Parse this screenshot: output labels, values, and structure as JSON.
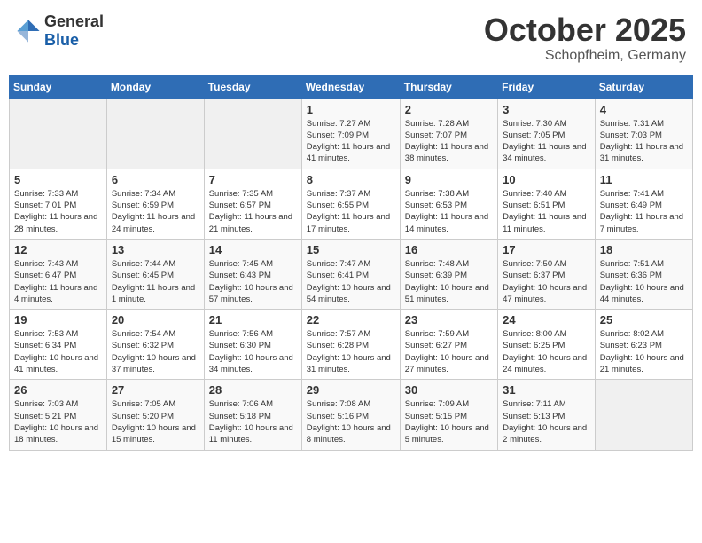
{
  "header": {
    "logo_general": "General",
    "logo_blue": "Blue",
    "month": "October 2025",
    "location": "Schopfheim, Germany"
  },
  "weekdays": [
    "Sunday",
    "Monday",
    "Tuesday",
    "Wednesday",
    "Thursday",
    "Friday",
    "Saturday"
  ],
  "weeks": [
    [
      {
        "day": "",
        "sunrise": "",
        "sunset": "",
        "daylight": ""
      },
      {
        "day": "",
        "sunrise": "",
        "sunset": "",
        "daylight": ""
      },
      {
        "day": "",
        "sunrise": "",
        "sunset": "",
        "daylight": ""
      },
      {
        "day": "1",
        "sunrise": "Sunrise: 7:27 AM",
        "sunset": "Sunset: 7:09 PM",
        "daylight": "Daylight: 11 hours and 41 minutes."
      },
      {
        "day": "2",
        "sunrise": "Sunrise: 7:28 AM",
        "sunset": "Sunset: 7:07 PM",
        "daylight": "Daylight: 11 hours and 38 minutes."
      },
      {
        "day": "3",
        "sunrise": "Sunrise: 7:30 AM",
        "sunset": "Sunset: 7:05 PM",
        "daylight": "Daylight: 11 hours and 34 minutes."
      },
      {
        "day": "4",
        "sunrise": "Sunrise: 7:31 AM",
        "sunset": "Sunset: 7:03 PM",
        "daylight": "Daylight: 11 hours and 31 minutes."
      }
    ],
    [
      {
        "day": "5",
        "sunrise": "Sunrise: 7:33 AM",
        "sunset": "Sunset: 7:01 PM",
        "daylight": "Daylight: 11 hours and 28 minutes."
      },
      {
        "day": "6",
        "sunrise": "Sunrise: 7:34 AM",
        "sunset": "Sunset: 6:59 PM",
        "daylight": "Daylight: 11 hours and 24 minutes."
      },
      {
        "day": "7",
        "sunrise": "Sunrise: 7:35 AM",
        "sunset": "Sunset: 6:57 PM",
        "daylight": "Daylight: 11 hours and 21 minutes."
      },
      {
        "day": "8",
        "sunrise": "Sunrise: 7:37 AM",
        "sunset": "Sunset: 6:55 PM",
        "daylight": "Daylight: 11 hours and 17 minutes."
      },
      {
        "day": "9",
        "sunrise": "Sunrise: 7:38 AM",
        "sunset": "Sunset: 6:53 PM",
        "daylight": "Daylight: 11 hours and 14 minutes."
      },
      {
        "day": "10",
        "sunrise": "Sunrise: 7:40 AM",
        "sunset": "Sunset: 6:51 PM",
        "daylight": "Daylight: 11 hours and 11 minutes."
      },
      {
        "day": "11",
        "sunrise": "Sunrise: 7:41 AM",
        "sunset": "Sunset: 6:49 PM",
        "daylight": "Daylight: 11 hours and 7 minutes."
      }
    ],
    [
      {
        "day": "12",
        "sunrise": "Sunrise: 7:43 AM",
        "sunset": "Sunset: 6:47 PM",
        "daylight": "Daylight: 11 hours and 4 minutes."
      },
      {
        "day": "13",
        "sunrise": "Sunrise: 7:44 AM",
        "sunset": "Sunset: 6:45 PM",
        "daylight": "Daylight: 11 hours and 1 minute."
      },
      {
        "day": "14",
        "sunrise": "Sunrise: 7:45 AM",
        "sunset": "Sunset: 6:43 PM",
        "daylight": "Daylight: 10 hours and 57 minutes."
      },
      {
        "day": "15",
        "sunrise": "Sunrise: 7:47 AM",
        "sunset": "Sunset: 6:41 PM",
        "daylight": "Daylight: 10 hours and 54 minutes."
      },
      {
        "day": "16",
        "sunrise": "Sunrise: 7:48 AM",
        "sunset": "Sunset: 6:39 PM",
        "daylight": "Daylight: 10 hours and 51 minutes."
      },
      {
        "day": "17",
        "sunrise": "Sunrise: 7:50 AM",
        "sunset": "Sunset: 6:37 PM",
        "daylight": "Daylight: 10 hours and 47 minutes."
      },
      {
        "day": "18",
        "sunrise": "Sunrise: 7:51 AM",
        "sunset": "Sunset: 6:36 PM",
        "daylight": "Daylight: 10 hours and 44 minutes."
      }
    ],
    [
      {
        "day": "19",
        "sunrise": "Sunrise: 7:53 AM",
        "sunset": "Sunset: 6:34 PM",
        "daylight": "Daylight: 10 hours and 41 minutes."
      },
      {
        "day": "20",
        "sunrise": "Sunrise: 7:54 AM",
        "sunset": "Sunset: 6:32 PM",
        "daylight": "Daylight: 10 hours and 37 minutes."
      },
      {
        "day": "21",
        "sunrise": "Sunrise: 7:56 AM",
        "sunset": "Sunset: 6:30 PM",
        "daylight": "Daylight: 10 hours and 34 minutes."
      },
      {
        "day": "22",
        "sunrise": "Sunrise: 7:57 AM",
        "sunset": "Sunset: 6:28 PM",
        "daylight": "Daylight: 10 hours and 31 minutes."
      },
      {
        "day": "23",
        "sunrise": "Sunrise: 7:59 AM",
        "sunset": "Sunset: 6:27 PM",
        "daylight": "Daylight: 10 hours and 27 minutes."
      },
      {
        "day": "24",
        "sunrise": "Sunrise: 8:00 AM",
        "sunset": "Sunset: 6:25 PM",
        "daylight": "Daylight: 10 hours and 24 minutes."
      },
      {
        "day": "25",
        "sunrise": "Sunrise: 8:02 AM",
        "sunset": "Sunset: 6:23 PM",
        "daylight": "Daylight: 10 hours and 21 minutes."
      }
    ],
    [
      {
        "day": "26",
        "sunrise": "Sunrise: 7:03 AM",
        "sunset": "Sunset: 5:21 PM",
        "daylight": "Daylight: 10 hours and 18 minutes."
      },
      {
        "day": "27",
        "sunrise": "Sunrise: 7:05 AM",
        "sunset": "Sunset: 5:20 PM",
        "daylight": "Daylight: 10 hours and 15 minutes."
      },
      {
        "day": "28",
        "sunrise": "Sunrise: 7:06 AM",
        "sunset": "Sunset: 5:18 PM",
        "daylight": "Daylight: 10 hours and 11 minutes."
      },
      {
        "day": "29",
        "sunrise": "Sunrise: 7:08 AM",
        "sunset": "Sunset: 5:16 PM",
        "daylight": "Daylight: 10 hours and 8 minutes."
      },
      {
        "day": "30",
        "sunrise": "Sunrise: 7:09 AM",
        "sunset": "Sunset: 5:15 PM",
        "daylight": "Daylight: 10 hours and 5 minutes."
      },
      {
        "day": "31",
        "sunrise": "Sunrise: 7:11 AM",
        "sunset": "Sunset: 5:13 PM",
        "daylight": "Daylight: 10 hours and 2 minutes."
      },
      {
        "day": "",
        "sunrise": "",
        "sunset": "",
        "daylight": ""
      }
    ]
  ]
}
